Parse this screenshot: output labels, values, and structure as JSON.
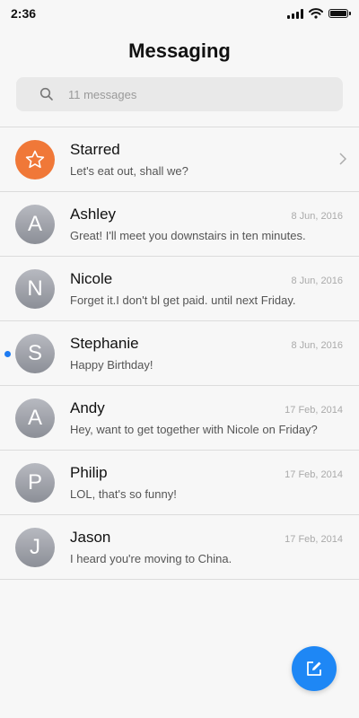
{
  "status_bar": {
    "time": "2:36",
    "icons": [
      "signal-icon",
      "wifi-icon",
      "battery-icon"
    ]
  },
  "header": {
    "title": "Messaging"
  },
  "search": {
    "placeholder": "11 messages",
    "icon": "search-icon"
  },
  "starred": {
    "name": "Starred",
    "preview": "Let's eat out, shall we?",
    "icon": "star-icon"
  },
  "conversations": [
    {
      "initial": "A",
      "name": "Ashley",
      "date": "8 Jun, 2016",
      "preview": "Great! I'll meet you downstairs in ten minutes."
    },
    {
      "initial": "N",
      "name": "Nicole",
      "date": "8 Jun, 2016",
      "preview": "Forget it.I don't bl get paid. until next Friday."
    },
    {
      "initial": "S",
      "name": "Stephanie",
      "date": "8 Jun, 2016",
      "preview": "Happy Birthday!",
      "unread": true
    },
    {
      "initial": "A",
      "name": "Andy",
      "date": "17 Feb, 2014",
      "preview": "Hey, want to get together with Nicole on Friday?"
    },
    {
      "initial": "P",
      "name": "Philip",
      "date": "17 Feb, 2014",
      "preview": "LOL, that's so funny!"
    },
    {
      "initial": "J",
      "name": "Jason",
      "date": "17 Feb, 2014",
      "preview": "I heard you're moving to China."
    }
  ],
  "colors": {
    "accent": "#1e87f5",
    "star_avatar": "#f07838",
    "unread_dot": "#1e7bf2"
  },
  "fab": {
    "icon": "compose-icon"
  }
}
